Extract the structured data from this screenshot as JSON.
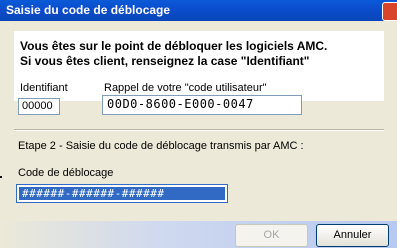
{
  "window": {
    "title": "Saisie du code de déblocage"
  },
  "header": {
    "line1": "Vous êtes sur le point de débloquer les logiciels AMC.",
    "line2": "Si vous êtes client, renseignez la case \"Identifiant\""
  },
  "identifiant": {
    "label": "Identifiant",
    "value": "00000"
  },
  "rappel": {
    "label": "Rappel de votre \"code utilisateur\"",
    "value": "00D0-8600-E000-0047"
  },
  "step2": {
    "text": "Etape 2 - Saisie du code de déblocage transmis par AMC :"
  },
  "code_deblocage": {
    "label": "Code de déblocage",
    "value": "######-######-######"
  },
  "buttons": {
    "ok": "OK",
    "cancel": "Annuler"
  }
}
